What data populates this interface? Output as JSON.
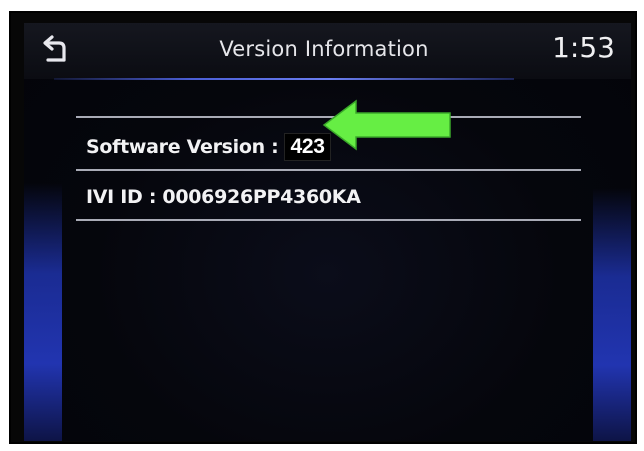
{
  "header": {
    "title": "Version Information",
    "clock": "1:53",
    "back_icon": "back-arrow-icon"
  },
  "info": {
    "software_version_label": "Software Version :",
    "software_version_value": "423",
    "ivi_id": "IVI ID : 0006926PP4360KA"
  },
  "annotation": {
    "arrow_icon": "green-arrow-icon",
    "arrow_color": "#66ee44"
  },
  "colors": {
    "accent_blue": "#3a4fd0",
    "divider": "#a9abb6"
  }
}
